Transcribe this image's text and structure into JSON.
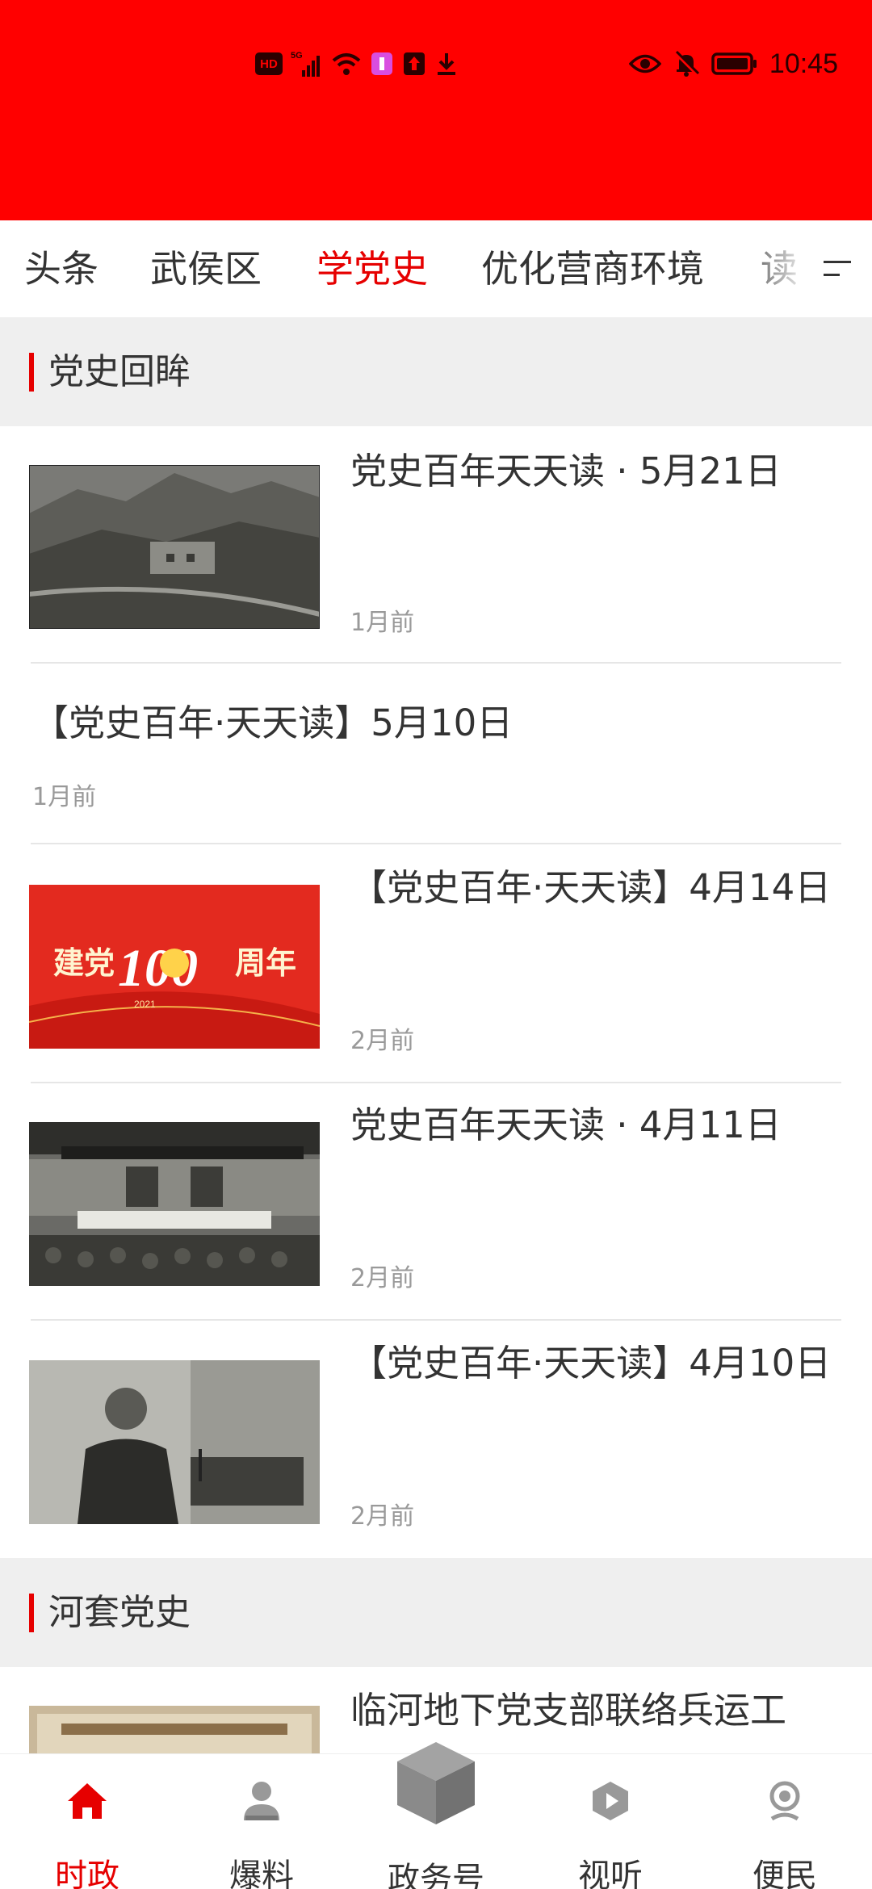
{
  "status_bar": {
    "time": "10:45",
    "left_icons": [
      "hd-icon",
      "signal-5g-icon",
      "wifi-icon",
      "app-notification-icon",
      "upload-icon",
      "download-icon"
    ],
    "right_icons": [
      "eye-icon",
      "bell-muted-icon",
      "battery-icon"
    ],
    "hd": "HD"
  },
  "colors": {
    "brand_red": "#ff0000",
    "accent_red": "#e60000",
    "section_bg": "#efefef",
    "muted": "#999999"
  },
  "tabs": [
    {
      "label": "头条",
      "active": false
    },
    {
      "label": "武侯区",
      "active": false
    },
    {
      "label": "学党史",
      "active": true
    },
    {
      "label": "优化营商环境",
      "active": false
    },
    {
      "label": "读",
      "active": false
    }
  ],
  "sections": [
    {
      "title": "党史回眸",
      "items": [
        {
          "title": "党史百年天天读 · 5月21日",
          "time": "1月前",
          "thumb": "mountain-village-photo"
        },
        {
          "title": "【党史百年·天天读】5月10日",
          "time": "1月前",
          "thumb": null
        },
        {
          "title": "【党史百年·天天读】4月14日",
          "time": "2月前",
          "thumb": "centenary-poster"
        },
        {
          "title": "党史百年天天读 · 4月11日",
          "time": "2月前",
          "thumb": "congress-hall-photo"
        },
        {
          "title": "【党史百年·天天读】4月10日",
          "time": "2月前",
          "thumb": "speaker-portrait-photo"
        }
      ]
    },
    {
      "title": "河套党史",
      "items": [
        {
          "title": "临河地下党支部联络兵运工",
          "time": "",
          "thumb": "banner-photo"
        }
      ]
    }
  ],
  "poster": {
    "left": "建党",
    "num": "100",
    "right": "周年",
    "year": "2021"
  },
  "bottom_nav": [
    {
      "label": "时政",
      "icon": "home-icon",
      "active": true
    },
    {
      "label": "爆料",
      "icon": "reporter-icon",
      "active": false
    },
    {
      "label": "政务号",
      "icon": "cube-icon",
      "active": false
    },
    {
      "label": "视听",
      "icon": "play-icon",
      "active": false
    },
    {
      "label": "便民",
      "icon": "service-icon",
      "active": false
    }
  ]
}
